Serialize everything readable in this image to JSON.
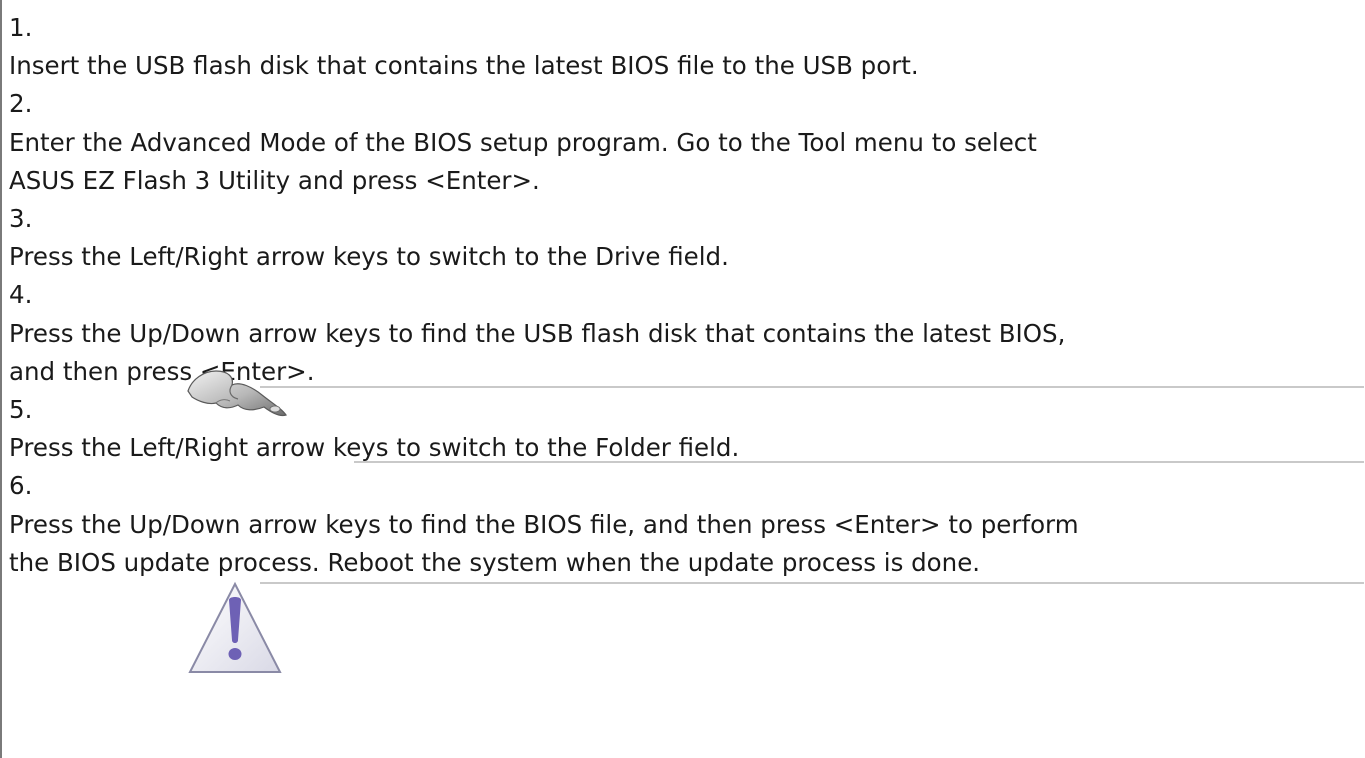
{
  "steps": [
    {
      "number": "1.",
      "lines": [
        "Insert the USB flash disk that contains the latest BIOS file to the USB port."
      ]
    },
    {
      "number": "2.",
      "lines": [
        "Enter the Advanced Mode of the BIOS setup program. Go to the Tool menu to select",
        "ASUS EZ Flash 3 Utility and press <Enter>."
      ]
    },
    {
      "number": "3.",
      "lines": [
        "Press the Left/Right arrow keys to switch to the Drive field."
      ]
    },
    {
      "number": "4.",
      "lines": [
        "Press the Up/Down arrow keys to find the USB flash disk that contains the latest BIOS,",
        "and then press <Enter>."
      ]
    },
    {
      "number": "5.",
      "lines": [
        "Press the Left/Right arrow keys to switch to the Folder field."
      ]
    },
    {
      "number": "6.",
      "lines": [
        "Press the Up/Down arrow keys to find the BIOS file, and then press <Enter> to perform",
        "the BIOS update process. Reboot the system when the update process is done."
      ]
    }
  ],
  "icons": {
    "note": "pointing-hand-icon",
    "warning": "warning-triangle-icon"
  }
}
